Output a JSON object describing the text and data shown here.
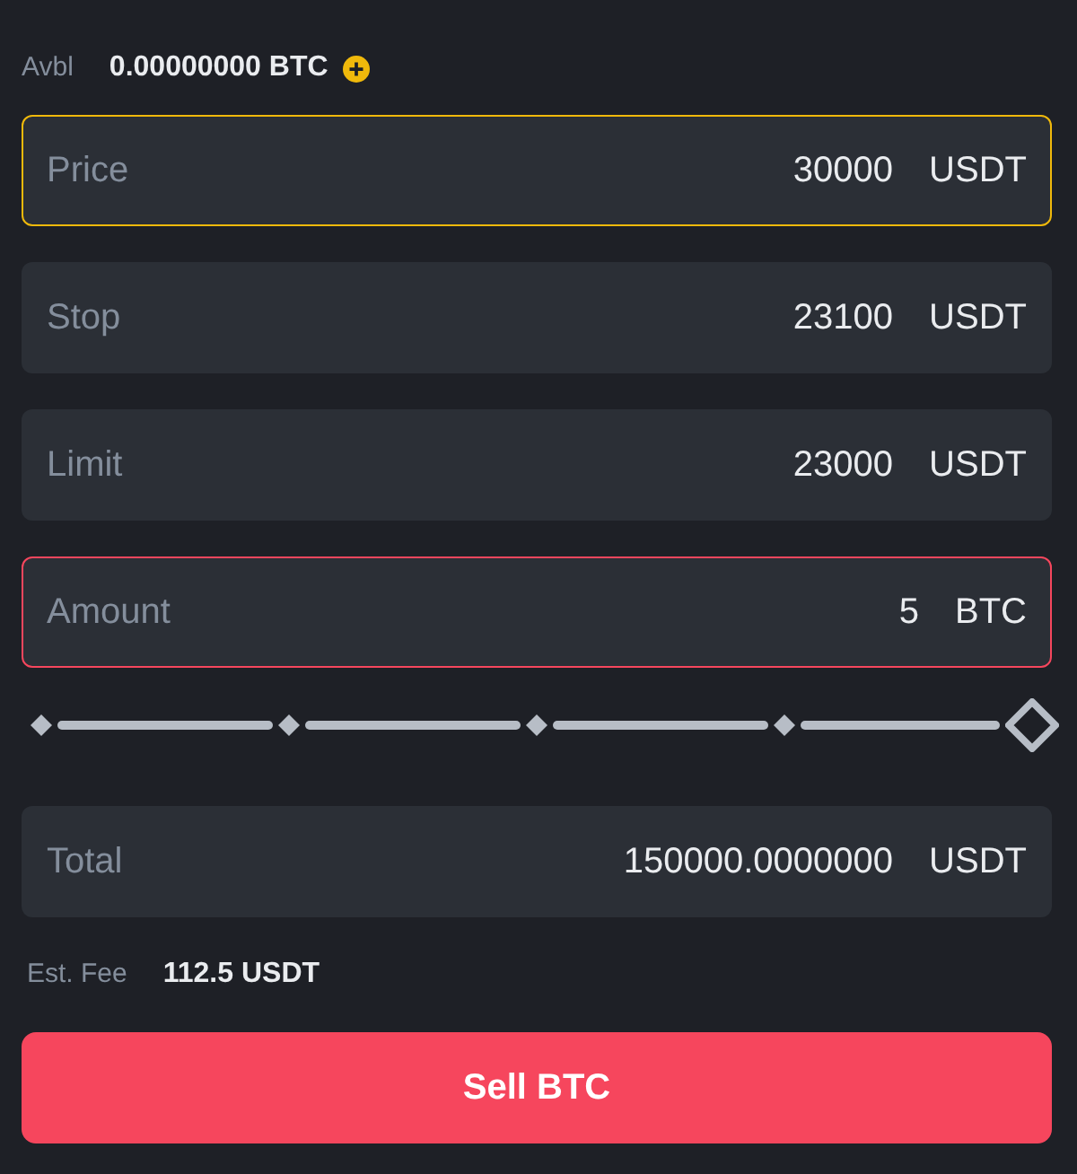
{
  "available": {
    "label": "Avbl",
    "value": "0.00000000 BTC"
  },
  "fields": [
    {
      "label": "Price",
      "value": "30000",
      "unit": "USDT",
      "focused": true,
      "error": false
    },
    {
      "label": "Stop",
      "value": "23100",
      "unit": "USDT",
      "focused": false,
      "error": false
    },
    {
      "label": "Limit",
      "value": "23000",
      "unit": "USDT",
      "focused": false,
      "error": false
    },
    {
      "label": "Amount",
      "value": "5",
      "unit": "BTC",
      "focused": false,
      "error": true
    }
  ],
  "slider": {
    "level": 1
  },
  "total": {
    "label": "Total",
    "value": "150000.0000000",
    "unit": "USDT"
  },
  "fee": {
    "label": "Est. Fee",
    "value": "112.5 USDT"
  },
  "submit": {
    "label": "Sell BTC"
  }
}
